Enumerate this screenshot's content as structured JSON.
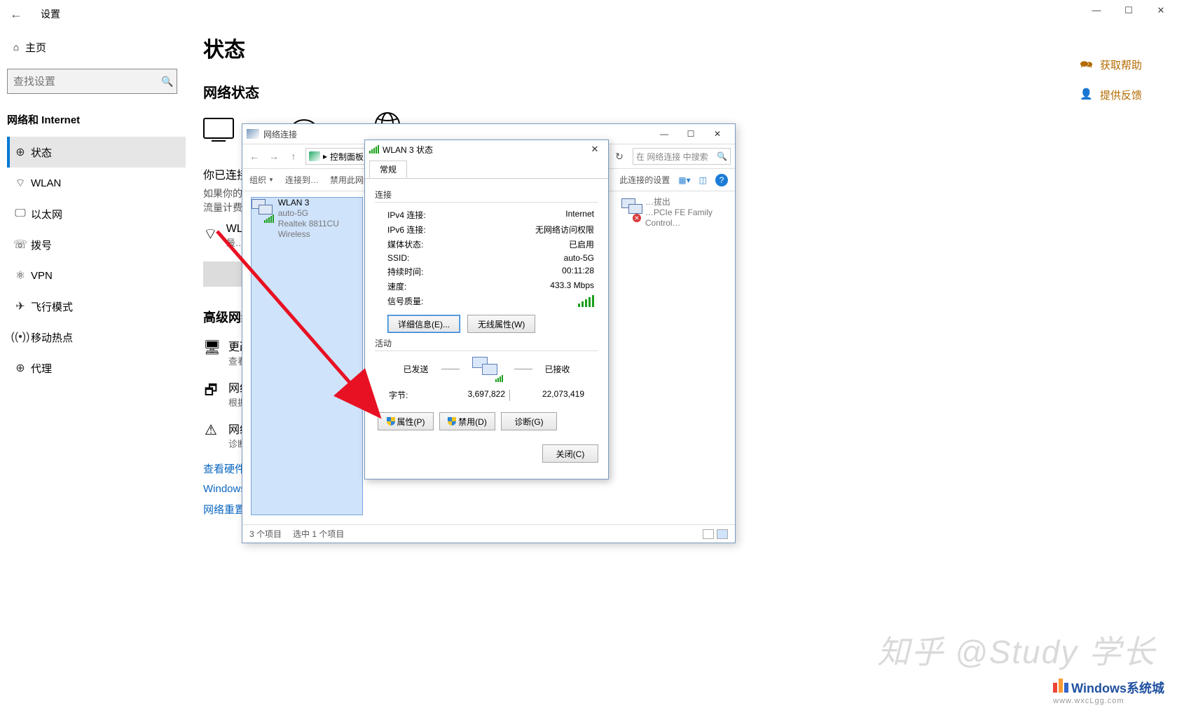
{
  "settings_window": {
    "back_icon": "←",
    "title": "设置",
    "win_buttons": {
      "min": "—",
      "max": "☐",
      "close": "✕"
    },
    "home_icon": "⌂",
    "home_label": "主页",
    "search_placeholder": "查找设置",
    "search_icon": "🔍",
    "section_header": "网络和 Internet",
    "items": [
      {
        "icon": "⊕",
        "label": "状态",
        "active": true
      },
      {
        "icon": "⌔",
        "label": "WLAN"
      },
      {
        "icon": "🖵",
        "label": "以太网"
      },
      {
        "icon": "☏",
        "label": "拨号"
      },
      {
        "icon": "⚛",
        "label": "VPN"
      },
      {
        "icon": "✈",
        "label": "飞行模式"
      },
      {
        "icon": "((•))",
        "label": "移动热点"
      },
      {
        "icon": "⊕",
        "label": "代理"
      }
    ],
    "right_links": [
      {
        "icon": "🗪",
        "label": "获取帮助"
      },
      {
        "icon": "👤",
        "label": "提供反馈"
      }
    ]
  },
  "status_page": {
    "h1": "状态",
    "h2": "网络状态",
    "connected_title": "你已连接……",
    "connected_sub1": "如果你的连……",
    "connected_sub2": "流量计费的……",
    "wlan_title": "WL…",
    "wlan_sub": "最…",
    "h3": "高级网络…",
    "options": [
      {
        "icon": "🖥",
        "title": "更改…",
        "sub": "查看…"
      },
      {
        "icon": "🗗",
        "title": "网络…",
        "sub": "根据…"
      },
      {
        "icon": "⚠",
        "title": "网络…",
        "sub": "诊断…"
      }
    ],
    "links": [
      "查看硬件…",
      "Windows …",
      "网络重置"
    ]
  },
  "explorer": {
    "title": "网络连接",
    "breadcrumb_parts": [
      "▸",
      "控制面板",
      "▸"
    ],
    "refresh_icon": "↻",
    "search_placeholder": "在 网络连接 中搜索",
    "toolbar": {
      "organize": "组织",
      "connect": "连接到…",
      "disable": "禁用此网络…",
      "diag_settings": "此连接的设置"
    },
    "items": [
      {
        "name": "WLAN 3",
        "line2": "auto-5G",
        "line3": "Realtek 8811CU Wireless",
        "selected": true,
        "status": "connected"
      },
      {
        "name": "…",
        "line2": "…拔出",
        "line3": "…PCIe FE Family Control…",
        "selected": false,
        "status": "disconnected"
      }
    ],
    "status_bar": {
      "count": "3 个项目",
      "selected": "选中 1 个项目"
    }
  },
  "dialog": {
    "title": "WLAN 3 状态",
    "close_icon": "✕",
    "tab": "常规",
    "group_conn": "连接",
    "rows": [
      {
        "k": "IPv4 连接:",
        "v": "Internet"
      },
      {
        "k": "IPv6 连接:",
        "v": "无网络访问权限"
      },
      {
        "k": "媒体状态:",
        "v": "已启用"
      },
      {
        "k": "SSID:",
        "v": "auto-5G"
      },
      {
        "k": "持续时间:",
        "v": "00:11:28"
      },
      {
        "k": "速度:",
        "v": "433.3 Mbps"
      }
    ],
    "signal_label": "信号质量:",
    "details_btn": "详细信息(E)...",
    "wireless_btn": "无线属性(W)",
    "group_act": "活动",
    "sent_label": "已发送",
    "recv_label": "已接收",
    "bytes_label": "字节:",
    "bytes_sent": "3,697,822",
    "bytes_recv": "22,073,419",
    "btn_props": "属性(P)",
    "btn_disable": "禁用(D)",
    "btn_diag": "诊断(G)",
    "btn_close": "关闭(C)"
  },
  "watermark": {
    "text": "知乎 @Study 学长",
    "brand": "Windows系统城",
    "url": "www.wxcLgg.com"
  }
}
